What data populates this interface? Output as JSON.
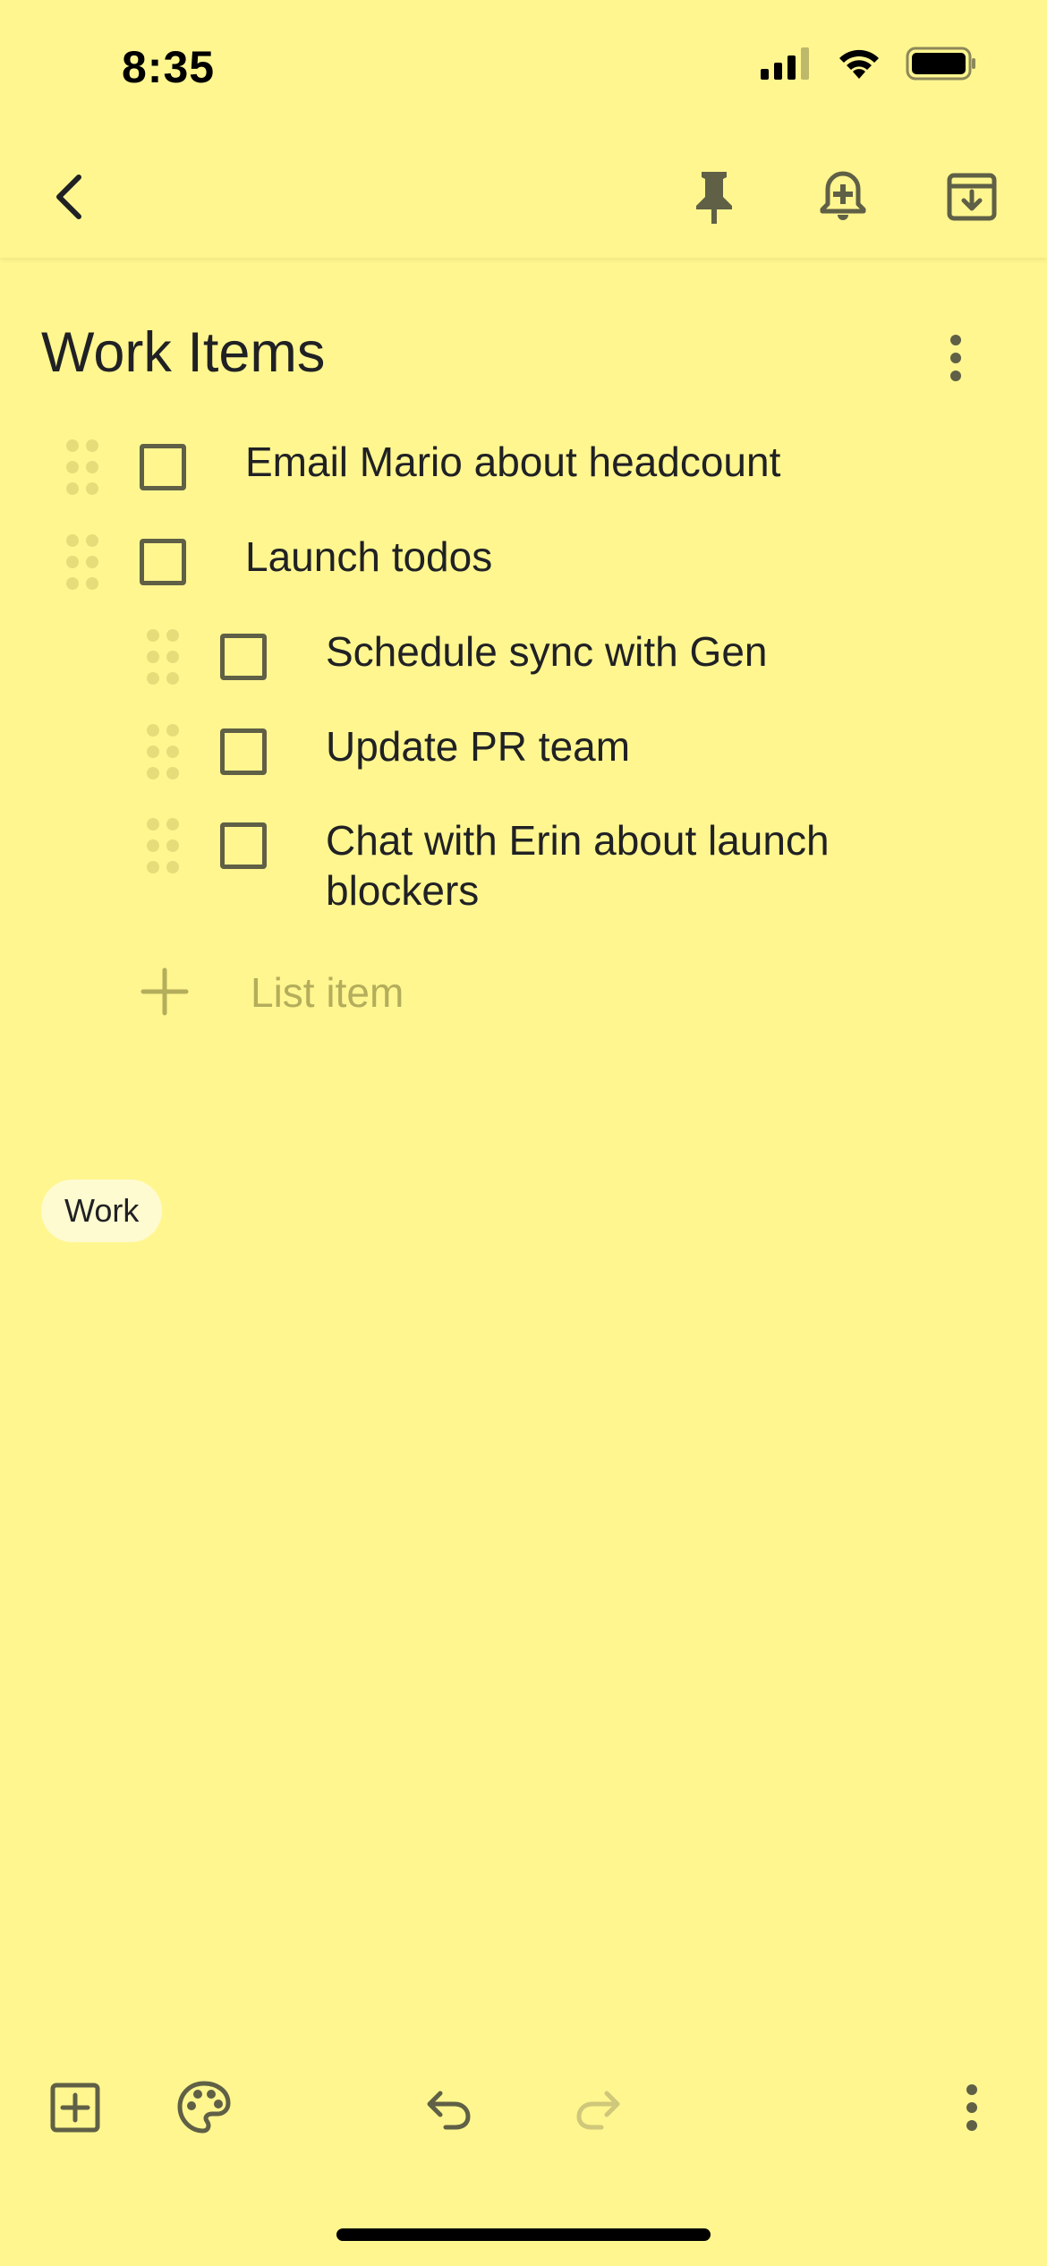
{
  "status_bar": {
    "time": "8:35"
  },
  "note": {
    "title": "Work Items",
    "items": [
      {
        "text": "Email Mario about headcount",
        "checked": false,
        "indent": 0
      },
      {
        "text": "Launch todos",
        "checked": false,
        "indent": 0
      },
      {
        "text": "Schedule sync with Gen",
        "checked": false,
        "indent": 1
      },
      {
        "text": "Update PR team",
        "checked": false,
        "indent": 1
      },
      {
        "text": "Chat with Erin about launch blockers",
        "checked": false,
        "indent": 1
      }
    ],
    "add_item_placeholder": "List item",
    "labels": [
      "Work"
    ]
  },
  "icons": {
    "back": "back-arrow-icon",
    "pin": "pin-icon",
    "reminder": "add-reminder-icon",
    "archive": "archive-icon",
    "more": "more-vertical-icon",
    "new": "add-box-icon",
    "palette": "palette-icon",
    "undo": "undo-icon",
    "redo": "redo-icon"
  },
  "colors": {
    "background": "#fff68f",
    "chip": "#fffbd0",
    "icon": "#5f6046",
    "placeholder": "#b3ad5c"
  }
}
